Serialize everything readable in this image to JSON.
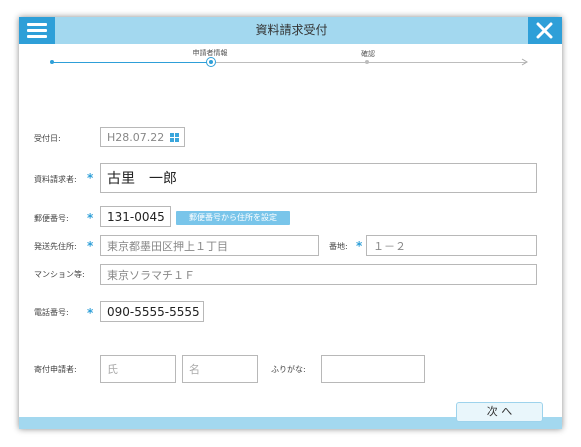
{
  "window": {
    "title": "資料請求受付"
  },
  "stepper": {
    "steps": [
      {
        "label": "申請者情報",
        "state": "current"
      },
      {
        "label": "確認",
        "state": "upcoming"
      }
    ]
  },
  "form": {
    "reception_date": {
      "label": "受付日:",
      "value": "H28.07.22"
    },
    "requester": {
      "label": "資料請求者:",
      "value": "古里　一郎"
    },
    "postal_code": {
      "label": "郵便番号:",
      "value": "131-0045",
      "lookup_button": "郵便番号から住所を設定"
    },
    "address": {
      "label": "発送先住所:",
      "value": "東京都墨田区押上１丁目"
    },
    "street_number": {
      "label": "番地:",
      "value": "１－２"
    },
    "building": {
      "label": "マンション等:",
      "value": "東京ソラマチ１Ｆ"
    },
    "phone": {
      "label": "電話番号:",
      "value": "090-5555-5555"
    },
    "donor": {
      "label": "寄付申請者:",
      "last_name_placeholder": "氏",
      "first_name_placeholder": "名",
      "furigana_label": "ふりがな:",
      "furigana_value": ""
    },
    "required_mark": "*"
  },
  "footer": {
    "next_label": "次 へ"
  },
  "colors": {
    "accent": "#2e9fd8",
    "titlebar": "#a3d8ef",
    "button": "#79c5ea"
  }
}
